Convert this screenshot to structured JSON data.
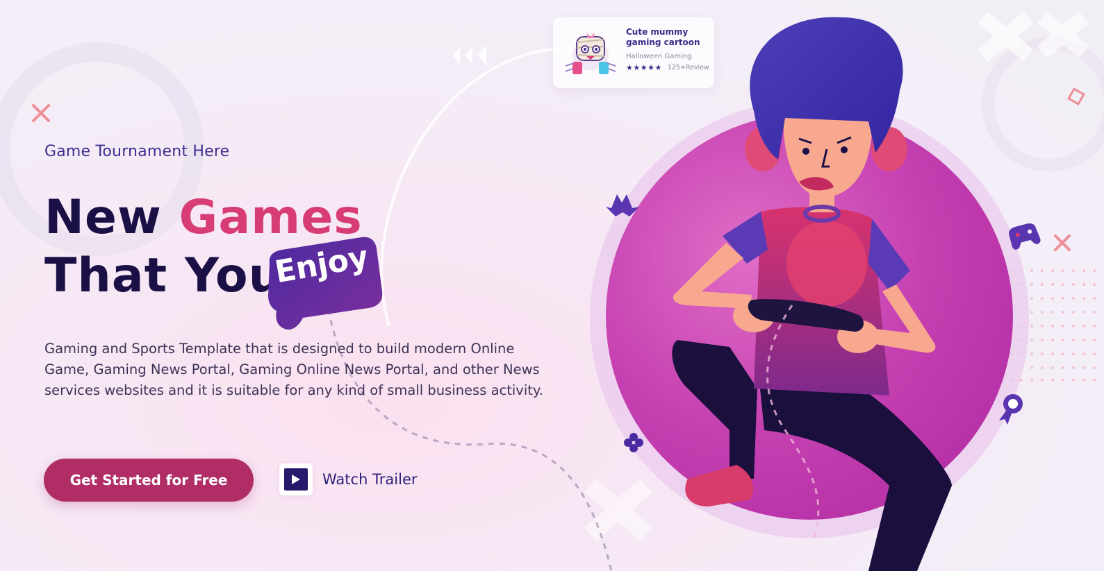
{
  "hero": {
    "eyebrow": "Game Tournament Here",
    "headline_part1": "New ",
    "headline_accent": "Games",
    "headline_part2": "That You",
    "badge_word": "Enjoy",
    "description": "Gaming and Sports Template that is designed to build modern Online Game, Gaming News Portal, Gaming Online News Portal, and other News services websites and it is suitable for any kind of small business activity.",
    "cta_label": "Get Started for Free",
    "trailer_label": "Watch Trailer"
  },
  "game_card": {
    "title": "Cute mummy gaming cartoon",
    "category": "Halloween Gaming",
    "rating_stars": "★★★★★",
    "reviews": "125+Review"
  },
  "icons": {
    "play": "play-icon",
    "gamepad_badge": "gamepad-badge",
    "bat": "bat-icon",
    "controller": "controller-icon",
    "award": "award-icon",
    "clover": "clover-icon",
    "cross": "cross-icon"
  },
  "colors": {
    "primary_dark": "#1a1045",
    "accent_pink": "#d73c76",
    "button": "#b02d66",
    "indigo": "#2d1f7c",
    "circle": "#c43fb0"
  }
}
